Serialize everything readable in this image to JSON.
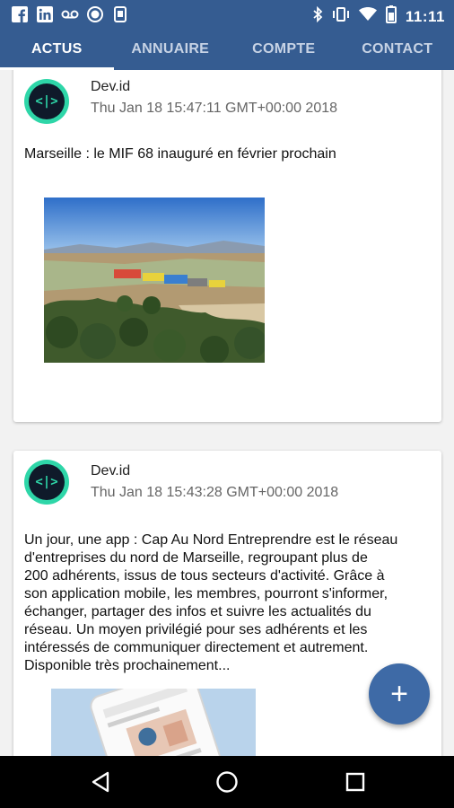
{
  "status_bar": {
    "left_icons": [
      "facebook-icon",
      "linkedin-icon",
      "voicemail-icon",
      "record-icon",
      "device-icon"
    ],
    "right_icons": [
      "bluetooth-icon",
      "vibrate-icon",
      "wifi-icon",
      "battery-icon"
    ],
    "time": "11:11"
  },
  "tabs": [
    {
      "label": "ACTUS",
      "active": true
    },
    {
      "label": "ANNUAIRE",
      "active": false
    },
    {
      "label": "COMPTE",
      "active": false
    },
    {
      "label": "CONTACT",
      "active": false
    }
  ],
  "posts": [
    {
      "author": "Dev.id",
      "avatar_text": "<|>",
      "date": "Thu Jan 18 15:47:11 GMT+00:00 2018",
      "text": "Marseille : le MIF 68 inauguré en février prochain",
      "image": "landscape-photo"
    },
    {
      "author": "Dev.id",
      "avatar_text": "<|>",
      "date": "Thu Jan 18 15:43:28 GMT+00:00 2018",
      "text_lines": [
        "Un jour, une app : Cap Au Nord Entreprendre est le réseau",
        "d'entreprises du nord de Marseille, regroupant plus de",
        "200 adhérents, issus de tous secteurs d'activité.  Grâce à",
        "son application mobile, les membres, pourront s'informer,",
        "échanger, partager des infos et suivre les actualités du",
        "réseau.  Un moyen privilégié pour ses adhérents et les",
        "intéressés de communiquer directement et autrement.",
        "Disponible très prochainement..."
      ],
      "image": "app-mockup-photo"
    }
  ],
  "fab": {
    "label": "+",
    "icon": "add-icon"
  },
  "nav_bar": {
    "buttons": [
      "back-icon",
      "home-icon",
      "recents-icon"
    ]
  },
  "colors": {
    "primary": "#355c91",
    "accent": "#3e6aa6",
    "avatar": "#2ed6a8"
  }
}
